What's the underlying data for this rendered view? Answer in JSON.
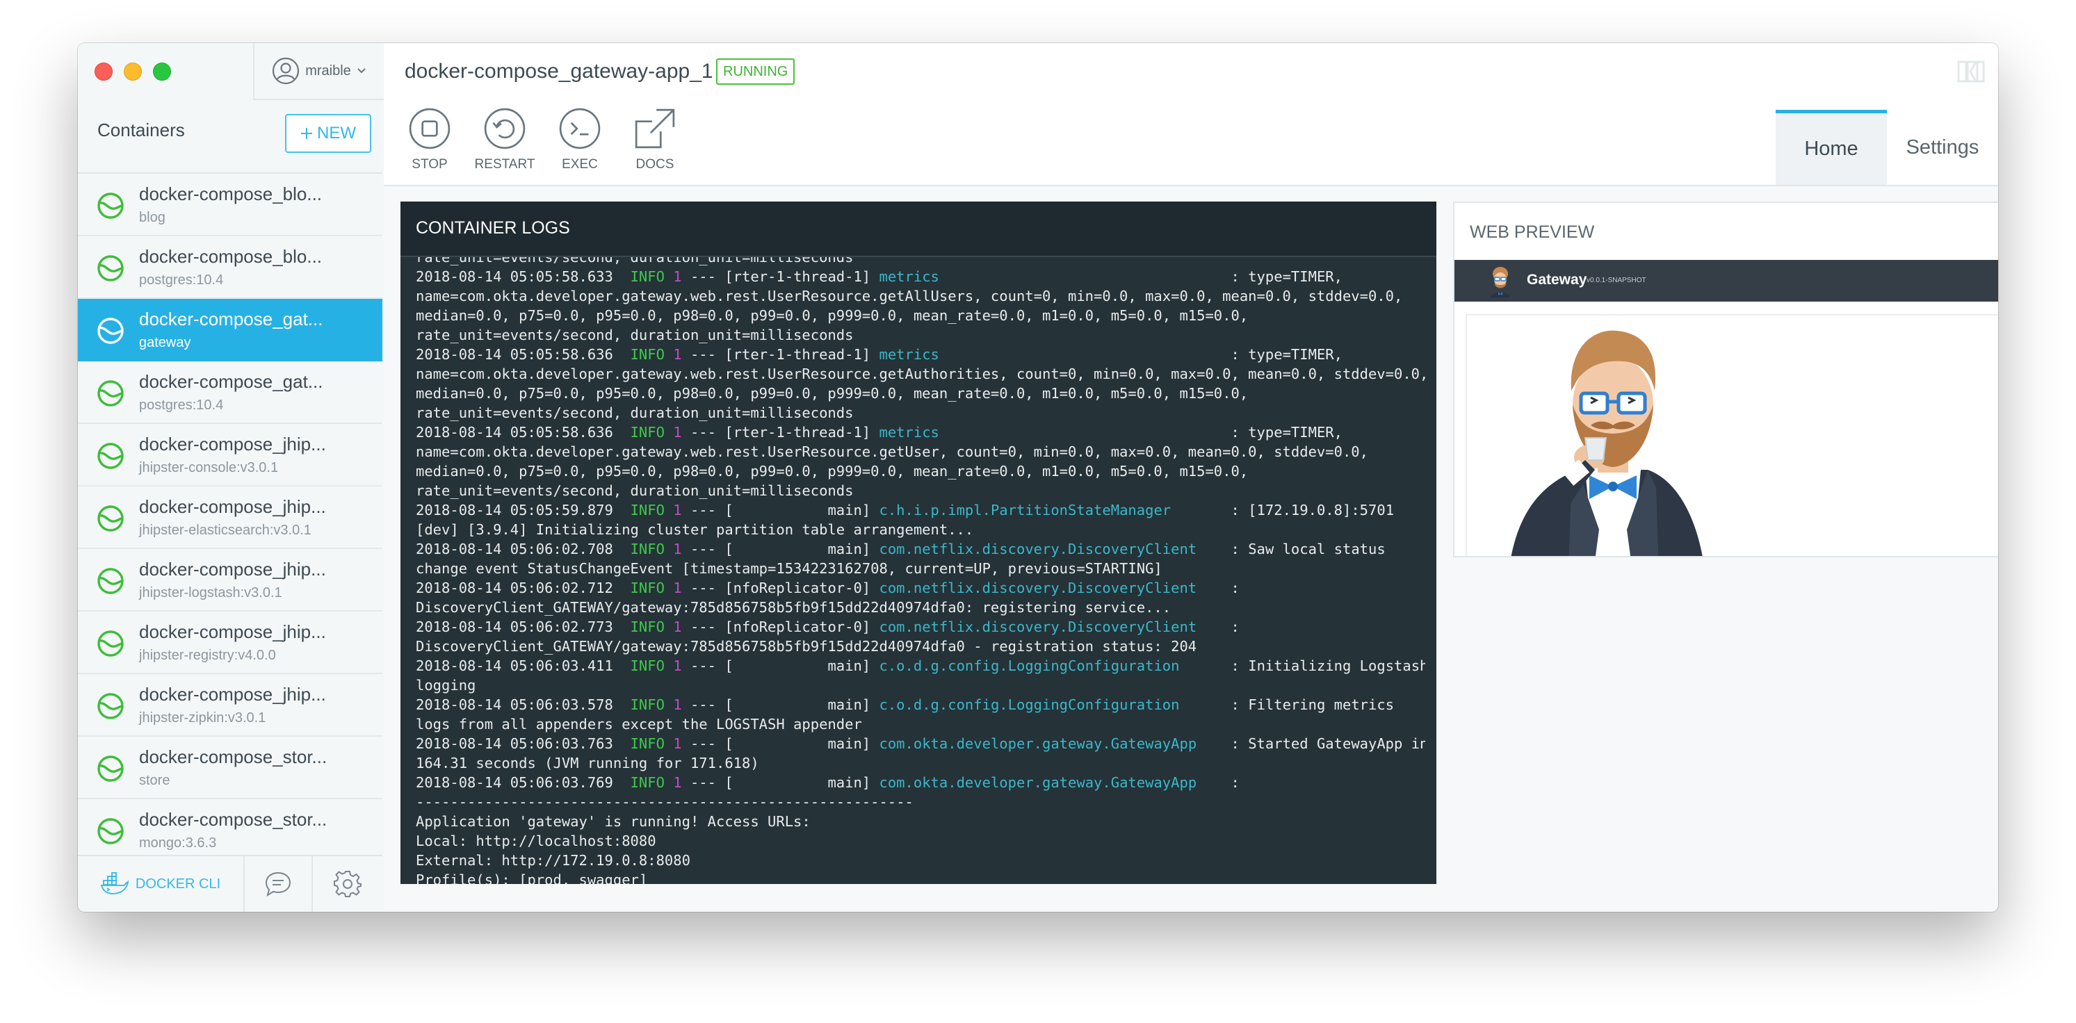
{
  "app": {
    "user": "mraible",
    "new_label": "NEW",
    "containers_title": "Containers"
  },
  "containers": [
    {
      "name": "docker-compose_blo...",
      "image": "blog",
      "active": false
    },
    {
      "name": "docker-compose_blo...",
      "image": "postgres:10.4",
      "active": false
    },
    {
      "name": "docker-compose_gat...",
      "image": "gateway",
      "active": true
    },
    {
      "name": "docker-compose_gat...",
      "image": "postgres:10.4",
      "active": false
    },
    {
      "name": "docker-compose_jhip...",
      "image": "jhipster-console:v3.0.1",
      "active": false
    },
    {
      "name": "docker-compose_jhip...",
      "image": "jhipster-elasticsearch:v3.0.1",
      "active": false
    },
    {
      "name": "docker-compose_jhip...",
      "image": "jhipster-logstash:v3.0.1",
      "active": false
    },
    {
      "name": "docker-compose_jhip...",
      "image": "jhipster-registry:v4.0.0",
      "active": false
    },
    {
      "name": "docker-compose_jhip...",
      "image": "jhipster-zipkin:v3.0.1",
      "active": false
    },
    {
      "name": "docker-compose_stor...",
      "image": "store",
      "active": false
    },
    {
      "name": "docker-compose_stor...",
      "image": "mongo:3.6.3",
      "active": false
    }
  ],
  "footer": {
    "docker_cli": "DOCKER CLI"
  },
  "header": {
    "container_name": "docker-compose_gateway-app_1",
    "status": "RUNNING",
    "actions": [
      {
        "label": "STOP",
        "icon": "stop-icon"
      },
      {
        "label": "RESTART",
        "icon": "restart-icon"
      },
      {
        "label": "EXEC",
        "icon": "terminal-icon"
      },
      {
        "label": "DOCS",
        "icon": "external-link-icon"
      }
    ],
    "tabs": [
      {
        "label": "Home",
        "active": true
      },
      {
        "label": "Settings",
        "active": false
      }
    ]
  },
  "logs": {
    "title": "CONTAINER LOGS",
    "lines": [
      [
        {
          "t": "rate_unit=events/second, duration_unit=milliseconds"
        }
      ],
      [
        {
          "t": "2018-08-14 05:05:58.633  "
        },
        {
          "t": "INFO",
          "c": "lv"
        },
        {
          "t": " "
        },
        {
          "t": "1",
          "c": "pid"
        },
        {
          "t": " --- [rter-1-thread-1] "
        },
        {
          "t": "metrics",
          "c": "lg"
        },
        {
          "t": "                                  : type=TIMER,"
        }
      ],
      [
        {
          "t": "name=com.okta.developer.gateway.web.rest.UserResource.getAllUsers, count=0, min=0.0, max=0.0, mean=0.0, stddev=0.0,"
        }
      ],
      [
        {
          "t": "median=0.0, p75=0.0, p95=0.0, p98=0.0, p99=0.0, p999=0.0, mean_rate=0.0, m1=0.0, m5=0.0, m15=0.0,"
        }
      ],
      [
        {
          "t": "rate_unit=events/second, duration_unit=milliseconds"
        }
      ],
      [
        {
          "t": "2018-08-14 05:05:58.636  "
        },
        {
          "t": "INFO",
          "c": "lv"
        },
        {
          "t": " "
        },
        {
          "t": "1",
          "c": "pid"
        },
        {
          "t": " --- [rter-1-thread-1] "
        },
        {
          "t": "metrics",
          "c": "lg"
        },
        {
          "t": "                                  : type=TIMER,"
        }
      ],
      [
        {
          "t": "name=com.okta.developer.gateway.web.rest.UserResource.getAuthorities, count=0, min=0.0, max=0.0, mean=0.0, stddev=0.0,"
        }
      ],
      [
        {
          "t": "median=0.0, p75=0.0, p95=0.0, p98=0.0, p99=0.0, p999=0.0, mean_rate=0.0, m1=0.0, m5=0.0, m15=0.0,"
        }
      ],
      [
        {
          "t": "rate_unit=events/second, duration_unit=milliseconds"
        }
      ],
      [
        {
          "t": "2018-08-14 05:05:58.636  "
        },
        {
          "t": "INFO",
          "c": "lv"
        },
        {
          "t": " "
        },
        {
          "t": "1",
          "c": "pid"
        },
        {
          "t": " --- [rter-1-thread-1] "
        },
        {
          "t": "metrics",
          "c": "lg"
        },
        {
          "t": "                                  : type=TIMER,"
        }
      ],
      [
        {
          "t": "name=com.okta.developer.gateway.web.rest.UserResource.getUser, count=0, min=0.0, max=0.0, mean=0.0, stddev=0.0,"
        }
      ],
      [
        {
          "t": "median=0.0, p75=0.0, p95=0.0, p98=0.0, p99=0.0, p999=0.0, mean_rate=0.0, m1=0.0, m5=0.0, m15=0.0,"
        }
      ],
      [
        {
          "t": "rate_unit=events/second, duration_unit=milliseconds"
        }
      ],
      [
        {
          "t": "2018-08-14 05:05:59.879  "
        },
        {
          "t": "INFO",
          "c": "lv"
        },
        {
          "t": " "
        },
        {
          "t": "1",
          "c": "pid"
        },
        {
          "t": " --- [           main] "
        },
        {
          "t": "c.h.i.p.impl.PartitionStateManager",
          "c": "lg"
        },
        {
          "t": "       : [172.19.0.8]:5701"
        }
      ],
      [
        {
          "t": "[dev] [3.9.4] Initializing cluster partition table arrangement..."
        }
      ],
      [
        {
          "t": "2018-08-14 05:06:02.708  "
        },
        {
          "t": "INFO",
          "c": "lv"
        },
        {
          "t": " "
        },
        {
          "t": "1",
          "c": "pid"
        },
        {
          "t": " --- [           main] "
        },
        {
          "t": "com.netflix.discovery.DiscoveryClient",
          "c": "lg"
        },
        {
          "t": "    : Saw local status"
        }
      ],
      [
        {
          "t": "change event StatusChangeEvent [timestamp=1534223162708, current=UP, previous=STARTING]"
        }
      ],
      [
        {
          "t": "2018-08-14 05:06:02.712  "
        },
        {
          "t": "INFO",
          "c": "lv"
        },
        {
          "t": " "
        },
        {
          "t": "1",
          "c": "pid"
        },
        {
          "t": " --- [nfoReplicator-0] "
        },
        {
          "t": "com.netflix.discovery.DiscoveryClient",
          "c": "lg"
        },
        {
          "t": "    :"
        }
      ],
      [
        {
          "t": "DiscoveryClient_GATEWAY/gateway:785d856758b5fb9f15dd22d40974dfa0: registering service..."
        }
      ],
      [
        {
          "t": "2018-08-14 05:06:02.773  "
        },
        {
          "t": "INFO",
          "c": "lv"
        },
        {
          "t": " "
        },
        {
          "t": "1",
          "c": "pid"
        },
        {
          "t": " --- [nfoReplicator-0] "
        },
        {
          "t": "com.netflix.discovery.DiscoveryClient",
          "c": "lg"
        },
        {
          "t": "    :"
        }
      ],
      [
        {
          "t": "DiscoveryClient_GATEWAY/gateway:785d856758b5fb9f15dd22d40974dfa0 - registration status: 204"
        }
      ],
      [
        {
          "t": "2018-08-14 05:06:03.411  "
        },
        {
          "t": "INFO",
          "c": "lv"
        },
        {
          "t": " "
        },
        {
          "t": "1",
          "c": "pid"
        },
        {
          "t": " --- [           main] "
        },
        {
          "t": "c.o.d.g.config.LoggingConfiguration",
          "c": "lg"
        },
        {
          "t": "      : Initializing Logstash"
        }
      ],
      [
        {
          "t": "logging"
        }
      ],
      [
        {
          "t": "2018-08-14 05:06:03.578  "
        },
        {
          "t": "INFO",
          "c": "lv"
        },
        {
          "t": " "
        },
        {
          "t": "1",
          "c": "pid"
        },
        {
          "t": " --- [           main] "
        },
        {
          "t": "c.o.d.g.config.LoggingConfiguration",
          "c": "lg"
        },
        {
          "t": "      : Filtering metrics"
        }
      ],
      [
        {
          "t": "logs from all appenders except the LOGSTASH appender"
        }
      ],
      [
        {
          "t": "2018-08-14 05:06:03.763  "
        },
        {
          "t": "INFO",
          "c": "lv"
        },
        {
          "t": " "
        },
        {
          "t": "1",
          "c": "pid"
        },
        {
          "t": " --- [           main] "
        },
        {
          "t": "com.okta.developer.gateway.GatewayApp",
          "c": "lg"
        },
        {
          "t": "    : Started GatewayApp in"
        }
      ],
      [
        {
          "t": "164.31 seconds (JVM running for 171.618)"
        }
      ],
      [
        {
          "t": "2018-08-14 05:06:03.769  "
        },
        {
          "t": "INFO",
          "c": "lv"
        },
        {
          "t": " "
        },
        {
          "t": "1",
          "c": "pid"
        },
        {
          "t": " --- [           main] "
        },
        {
          "t": "com.okta.developer.gateway.GatewayApp",
          "c": "lg"
        },
        {
          "t": "    :"
        }
      ],
      [
        {
          "t": "----------------------------------------------------------"
        }
      ],
      [
        {
          "t": "Application 'gateway' is running! Access URLs:"
        }
      ],
      [
        {
          "t": "Local: http://localhost:8080"
        }
      ],
      [
        {
          "t": "External: http://172.19.0.8:8080"
        }
      ],
      [
        {
          "t": "Profile(s): [prod, swagger]"
        }
      ]
    ]
  },
  "preview": {
    "title": "WEB PREVIEW",
    "brand": "Gateway",
    "version": "v0.0.1-SNAPSHOT"
  },
  "colors": {
    "accent": "#26b1e5",
    "running": "#4cc03b",
    "log_bg": "#253238",
    "log_info": "#3ec94a",
    "log_pid": "#c34cc3",
    "log_logger": "#3ab8c9"
  }
}
